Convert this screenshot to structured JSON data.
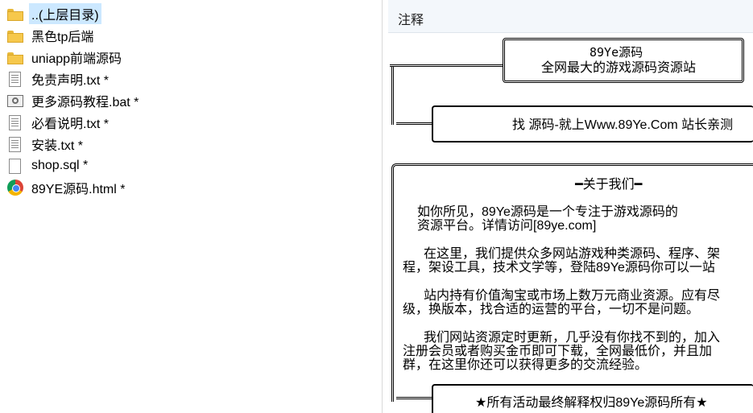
{
  "files": [
    {
      "icon": "folder-icon",
      "label": "..(上层目录)",
      "selected": true
    },
    {
      "icon": "folder-icon",
      "label": "黑色tp后端"
    },
    {
      "icon": "folder-icon",
      "label": "uniapp前端源码"
    },
    {
      "icon": "txt-icon",
      "label": "免责声明.txt *"
    },
    {
      "icon": "bat-icon",
      "label": "更多源码教程.bat *"
    },
    {
      "icon": "txt-icon",
      "label": "必看说明.txt *"
    },
    {
      "icon": "txt-icon",
      "label": "安装.txt *"
    },
    {
      "icon": "file-icon",
      "label": "shop.sql *"
    },
    {
      "icon": "chrome-icon",
      "label": "89YE源码.html *"
    }
  ],
  "notes": {
    "header": "注释",
    "banner_line1": "89Ye源码",
    "banner_line2": "全网最大的游戏源码资源站",
    "find_line": "找 源码-就上Www.89Ye.Com 站长亲测",
    "about_title": "━关于我们━",
    "para1": [
      "如你所见，89Ye源码是一个专注于游戏源码的",
      "资源平台。详情访问[89ye.com]"
    ],
    "para2": [
      "在这里，我们提供众多网站游戏种类源码、程序、架",
      "程，架设工具，技术文学等，登陆89Ye源码你可以一站"
    ],
    "para3": [
      "站内持有价值淘宝或市场上数万元商业资源。应有尽",
      "级，换版本，找合适的运营的平台，一切不是问题。"
    ],
    "para4": [
      "我们网站资源定时更新，几乎没有你找不到的，加入",
      "注册会员或者购买金币即可下载，全网最低价，并且加",
      "群，在这里你还可以获得更多的交流经验。"
    ],
    "footer_line": "★所有活动最终解释权归89Ye源码所有★"
  }
}
